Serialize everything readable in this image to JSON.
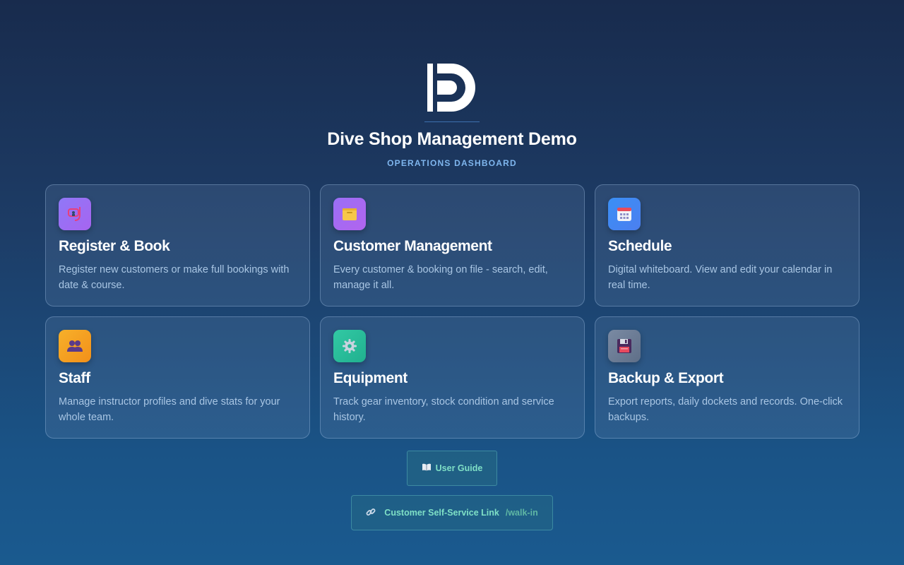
{
  "header": {
    "logo_icon": "ds-logo",
    "title": "Dive Shop Management Demo",
    "subtitle": "OPERATIONS DASHBOARD"
  },
  "cards": [
    {
      "id": "register",
      "icon": "dive-mask-icon",
      "icon_color": "#9b6cf5",
      "title": "Register & Book",
      "description": "Register new customers or make full bookings with date & course."
    },
    {
      "id": "customers",
      "icon": "folder-icon",
      "icon_color": "#a06af3",
      "title": "Customer Management",
      "description": "Every customer & booking on file - search, edit, manage it all."
    },
    {
      "id": "schedule",
      "icon": "calendar-icon",
      "icon_color": "#3b8cf0",
      "title": "Schedule",
      "description": "Digital whiteboard. View and edit your calendar in real time."
    },
    {
      "id": "staff",
      "icon": "people-icon",
      "icon_color": "#f5a021",
      "title": "Staff",
      "description": "Manage instructor profiles and dive stats for your whole team."
    },
    {
      "id": "equipment",
      "icon": "gear-icon",
      "icon_color": "#2fc3a0",
      "title": "Equipment",
      "description": "Track gear inventory, stock condition and service history."
    },
    {
      "id": "backup",
      "icon": "floppy-disk-icon",
      "icon_color": "#6f7f96",
      "title": "Backup & Export",
      "description": "Export reports, daily dockets and records. One-click backups."
    }
  ],
  "footer": {
    "guide_icon": "book-icon",
    "guide_label": "User Guide",
    "self_service_icon": "link-icon",
    "self_service_label": "Customer Self-Service Link",
    "self_service_path": "/walk-in"
  }
}
